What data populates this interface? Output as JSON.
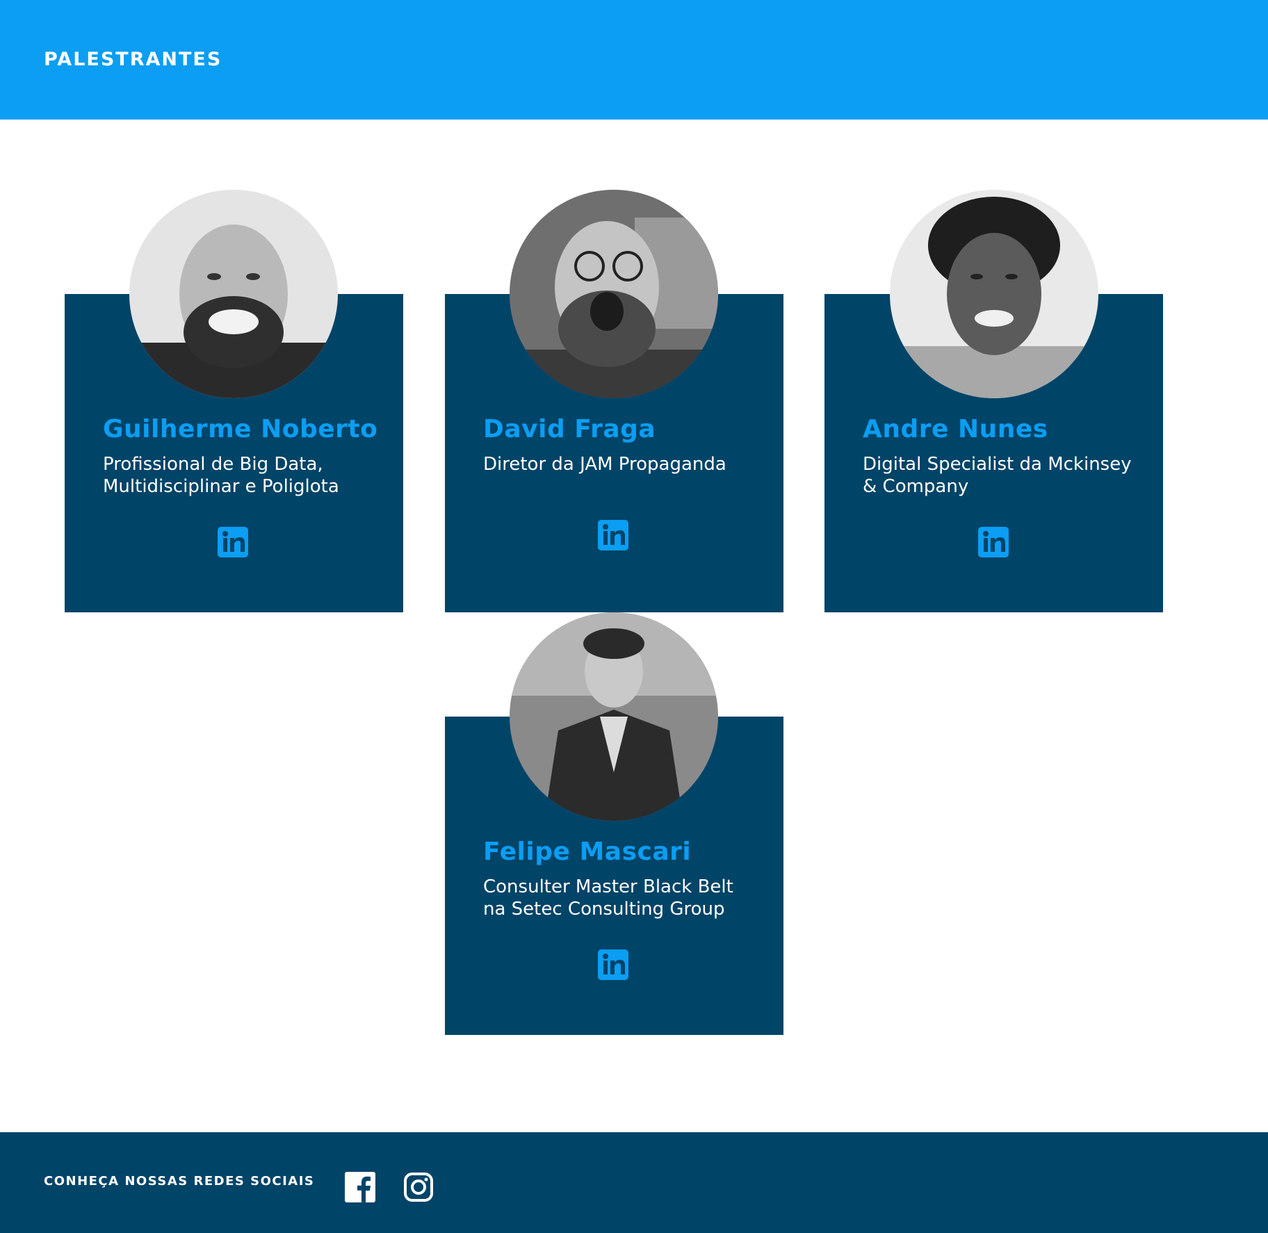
{
  "header": {
    "title": "PALESTRANTES"
  },
  "speakers": [
    {
      "name": "Guilherme Noberto",
      "role": "Profissional de Big Data, Multidisciplinar e Poliglota",
      "link_icon": "linkedin-icon"
    },
    {
      "name": "David Fraga",
      "role": "Diretor da JAM Propaganda",
      "link_icon": "linkedin-icon"
    },
    {
      "name": "Andre Nunes",
      "role": "Digital Specialist da Mckinsey & Company",
      "link_icon": "linkedin-icon"
    },
    {
      "name": "Felipe Mascari",
      "role": "Consulter Master Black Belt na Setec Consulting Group",
      "link_icon": "linkedin-icon"
    }
  ],
  "footer": {
    "label": "CONHEÇA NOSSAS REDES SOCIAIS",
    "social_icons": [
      "facebook-icon",
      "instagram-icon"
    ]
  },
  "colors": {
    "header_bg": "#0b9ef3",
    "card_bg": "#004468",
    "accent": "#0b9ef3",
    "footer_bg": "#004468"
  }
}
